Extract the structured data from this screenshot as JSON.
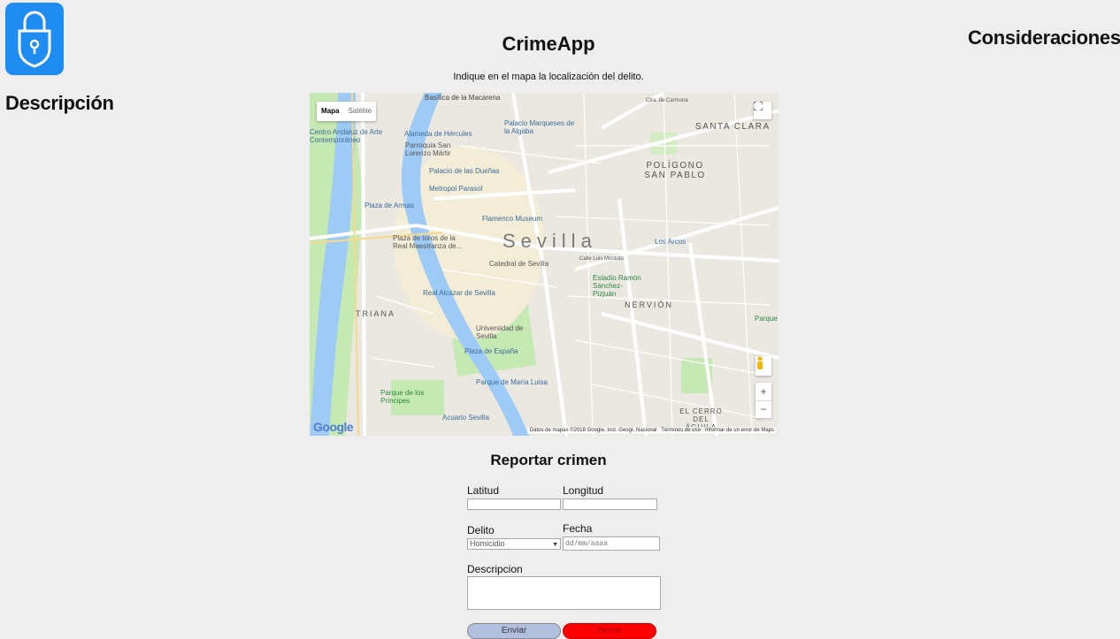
{
  "app": {
    "title": "CrimeApp",
    "instructions": "Indique en el mapa la localización del delito."
  },
  "sidebar_left": {
    "title": "Descripción"
  },
  "sidebar_right": {
    "title": "Consideraciones"
  },
  "logo": {
    "icon": "lock-shield-icon",
    "color": "#1e8cf2"
  },
  "map": {
    "type_control": {
      "map": "Mapa",
      "satellite": "Satélite"
    },
    "city_label": "Sevilla",
    "place_labels": [
      "Basílica de la Macarena",
      "Palacio Marqueses de la Algaba",
      "Centro Andaluz de Arte Contemporáneo",
      "Alameda de Hércules",
      "Parroquia San Lorenzo Mártir",
      "Palacio de las Dueñas",
      "Metropol Parasol",
      "Plaza de Armas",
      "Flamenco Museum",
      "Plaza de toros de la Real Maestranza de...",
      "Catedral de Sevilla",
      "Calle Luis Montoto",
      "Estadio Ramón Sánchez-Pizjuán",
      "Real Alcázar de Sevilla",
      "Universidad de Sevilla",
      "Plaza de España",
      "Parque de María Luisa",
      "Parque de los Príncipes",
      "Acuario Sevilla",
      "Los Arcos",
      "Parque",
      "Ctra. de Carmona"
    ],
    "district_labels": [
      "SANTA CLARA",
      "POLÍGONO SAN PABLO",
      "NERVIÓN",
      "TRIANA",
      "EL CERRO DEL ÁGUILA"
    ],
    "attribution": "Datos de mapas ©2018 Google, Inst. Geogr. Nacional",
    "terms": "Términos de uso",
    "report_error": "Informar de un error de Maps",
    "google": "Google",
    "zoom_in": "+",
    "zoom_out": "−"
  },
  "form": {
    "title": "Reportar crimen",
    "latitude_label": "Latitud",
    "latitude_value": "",
    "longitude_label": "Longitud",
    "longitude_value": "",
    "crime_label": "Delito",
    "crime_selected": "Homicidio",
    "date_label": "Fecha",
    "date_placeholder": "dd/mm/aaaa",
    "description_label": "Descripcion",
    "description_value": "",
    "send_label": "Enviar",
    "clear_label": "Borrar"
  },
  "colors": {
    "background": "#eeeeee",
    "logo": "#1e8cf2",
    "send_button": "#b0c0de",
    "clear_button": "#ff0000",
    "river": "#9ecbf5",
    "park": "#c6e8b3"
  }
}
